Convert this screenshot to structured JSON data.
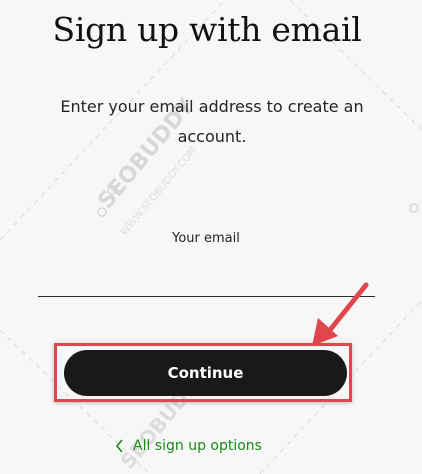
{
  "signup": {
    "title": "Sign up with email",
    "subtitle": "Enter your email address to create an account.",
    "email_label": "Your email",
    "email_value": "",
    "continue_label": "Continue",
    "back_link_label": "All sign up options"
  },
  "watermark": {
    "text": "SEOBUDDY",
    "subtext": "WWW.SEOBUDDY.COM"
  },
  "colors": {
    "background": "#f7f7f7",
    "button": "#191919",
    "link": "#1a8917",
    "annotation": "#e0474c"
  },
  "icons": {
    "back_link": "chevron-left-icon",
    "annotation_arrow": "arrow-icon"
  }
}
